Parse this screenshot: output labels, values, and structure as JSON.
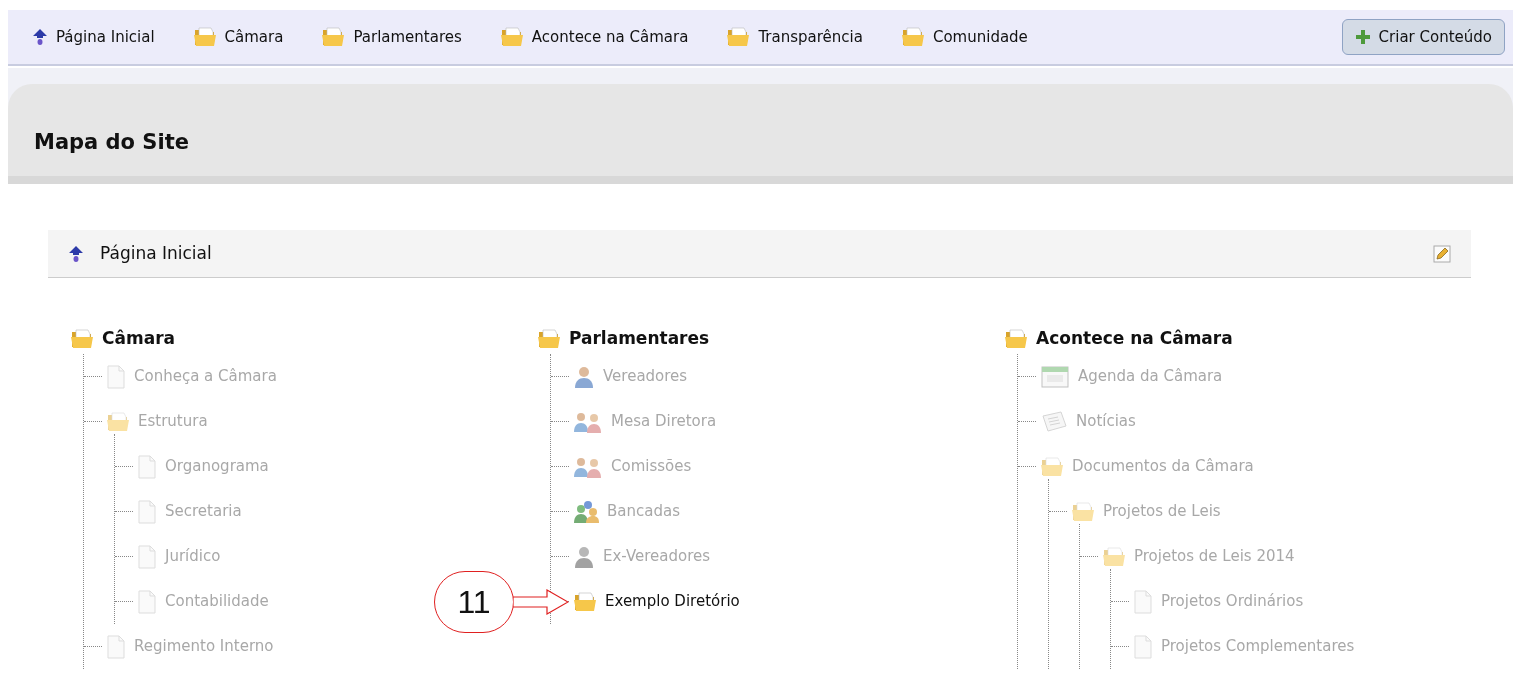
{
  "nav": {
    "items": [
      {
        "label": "Página Inicial",
        "kind": "home"
      },
      {
        "label": "Câmara",
        "kind": "folder"
      },
      {
        "label": "Parlamentares",
        "kind": "folder"
      },
      {
        "label": "Acontece na Câmara",
        "kind": "folder"
      },
      {
        "label": "Transparência",
        "kind": "folder"
      },
      {
        "label": "Comunidade",
        "kind": "folder"
      }
    ],
    "create_button": "Criar Conteúdo"
  },
  "page_title": "Mapa do Site",
  "root": {
    "label": "Página Inicial"
  },
  "columns": [
    {
      "title": "Câmara",
      "children": [
        {
          "label": "Conheça a Câmara",
          "kind": "page",
          "dimmed": true
        },
        {
          "label": "Estrutura",
          "kind": "folder",
          "dimmed": true,
          "children": [
            {
              "label": "Organograma",
              "kind": "page",
              "dimmed": true
            },
            {
              "label": "Secretaria",
              "kind": "page",
              "dimmed": true
            },
            {
              "label": "Jurídico",
              "kind": "page",
              "dimmed": true
            },
            {
              "label": "Contabilidade",
              "kind": "page",
              "dimmed": true
            }
          ]
        },
        {
          "label": "Regimento Interno",
          "kind": "page",
          "dimmed": true
        }
      ]
    },
    {
      "title": "Parlamentares",
      "children": [
        {
          "label": "Vereadores",
          "kind": "person",
          "dimmed": true
        },
        {
          "label": "Mesa Diretora",
          "kind": "people",
          "dimmed": true
        },
        {
          "label": "Comissões",
          "kind": "people",
          "dimmed": true
        },
        {
          "label": "Bancadas",
          "kind": "group",
          "dimmed": true
        },
        {
          "label": "Ex-Vereadores",
          "kind": "former",
          "dimmed": true
        },
        {
          "label": "Exemplo Diretório",
          "kind": "folder",
          "dimmed": false,
          "callout": "11"
        }
      ]
    },
    {
      "title": "Acontece na Câmara",
      "children": [
        {
          "label": "Agenda da Câmara",
          "kind": "calendar",
          "dimmed": true
        },
        {
          "label": "Notícias",
          "kind": "news",
          "dimmed": true
        },
        {
          "label": "Documentos da Câmara",
          "kind": "folder",
          "dimmed": true,
          "children": [
            {
              "label": "Projetos de Leis",
              "kind": "folder",
              "dimmed": true,
              "children": [
                {
                  "label": "Projetos de Leis 2014",
                  "kind": "folder",
                  "dimmed": true,
                  "children": [
                    {
                      "label": "Projetos Ordinários",
                      "kind": "page",
                      "dimmed": true
                    },
                    {
                      "label": "Projetos Complementares",
                      "kind": "page",
                      "dimmed": true
                    }
                  ]
                }
              ]
            }
          ]
        }
      ]
    }
  ]
}
